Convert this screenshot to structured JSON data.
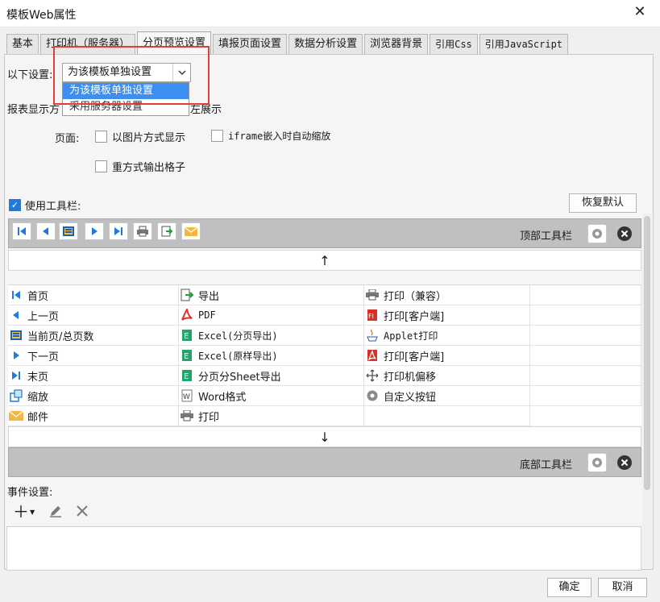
{
  "window": {
    "title": "模板Web属性"
  },
  "tabs": [
    {
      "label": "基本"
    },
    {
      "label": "打印机（服务器）"
    },
    {
      "label": "分页预览设置",
      "active": true
    },
    {
      "label": "填报页面设置"
    },
    {
      "label": "数据分析设置"
    },
    {
      "label": "浏览器背景"
    },
    {
      "label": "引用Css"
    },
    {
      "label": "引用JavaScript"
    }
  ],
  "settings": {
    "label": "以下设置:",
    "selected": "为该模板单独设置",
    "options": [
      "为该模板单独设置",
      "采用服务器设置"
    ]
  },
  "report_display": {
    "label_left": "报表显示方",
    "label_right": "左展示"
  },
  "page_options": {
    "label": "页面:",
    "image_mode": "以图片方式显示",
    "iframe_zoom": "iframe嵌入时自动缩放",
    "repeat_cells": "重方式输出格子"
  },
  "toolbar": {
    "use_toolbar_label": "使用工具栏:",
    "use_toolbar_checked": true,
    "restore_default": "恢复默认",
    "top_label": "顶部工具栏",
    "bottom_label": "底部工具栏",
    "up_arrow": "↑",
    "down_arrow": "↓"
  },
  "items": {
    "col1": [
      {
        "label": "首页",
        "icon": "first-page-icon"
      },
      {
        "label": "上一页",
        "icon": "prev-page-icon"
      },
      {
        "label": "当前页/总页数",
        "icon": "page-count-icon"
      },
      {
        "label": "下一页",
        "icon": "next-page-icon"
      },
      {
        "label": "末页",
        "icon": "last-page-icon"
      },
      {
        "label": "缩放",
        "icon": "zoom-icon"
      },
      {
        "label": "邮件",
        "icon": "mail-icon"
      }
    ],
    "col2": [
      {
        "label": "导出",
        "icon": "export-icon"
      },
      {
        "label": "PDF",
        "icon": "pdf-icon"
      },
      {
        "label": "Excel(分页导出)",
        "icon": "excel-icon"
      },
      {
        "label": "Excel(原样导出)",
        "icon": "excel-icon"
      },
      {
        "label": "分页分Sheet导出",
        "icon": "excel-icon"
      },
      {
        "label": "Word格式",
        "icon": "word-icon"
      },
      {
        "label": "打印",
        "icon": "print-icon"
      }
    ],
    "col3": [
      {
        "label": "打印（兼容）",
        "icon": "print-icon"
      },
      {
        "label": "打印[客户端]",
        "icon": "flash-print-icon"
      },
      {
        "label": "Applet打印",
        "icon": "applet-print-icon"
      },
      {
        "label": "打印[客户端]",
        "icon": "pdf-print-icon"
      },
      {
        "label": "打印机偏移",
        "icon": "move-icon"
      },
      {
        "label": "自定义按钮",
        "icon": "gear-icon"
      }
    ]
  },
  "events": {
    "label": "事件设置:"
  },
  "footer": {
    "ok": "确定",
    "cancel": "取消"
  },
  "colors": {
    "accent": "#1f7ae0",
    "highlight": "#e23b3b",
    "strip": "#c0c0c0"
  }
}
